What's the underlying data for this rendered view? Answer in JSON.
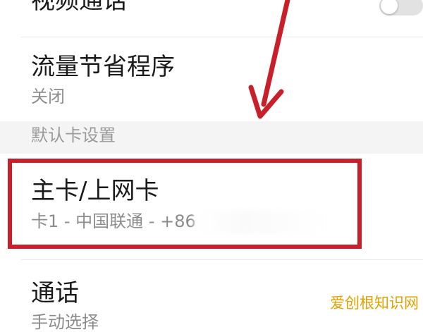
{
  "settings": {
    "video_call": {
      "label": "视频通话",
      "toggle": false
    },
    "data_saver": {
      "label": "流量节省程序",
      "value": "关闭"
    },
    "default_card_header": "默认卡设置",
    "primary_card": {
      "label": "主卡/上网卡",
      "value_prefix": "卡1 - 中国联通 - +86"
    },
    "calls": {
      "label": "通话",
      "value": "手动选择"
    }
  },
  "annotation": {
    "color": "#c8202b"
  },
  "watermark": "爱创根知识网"
}
